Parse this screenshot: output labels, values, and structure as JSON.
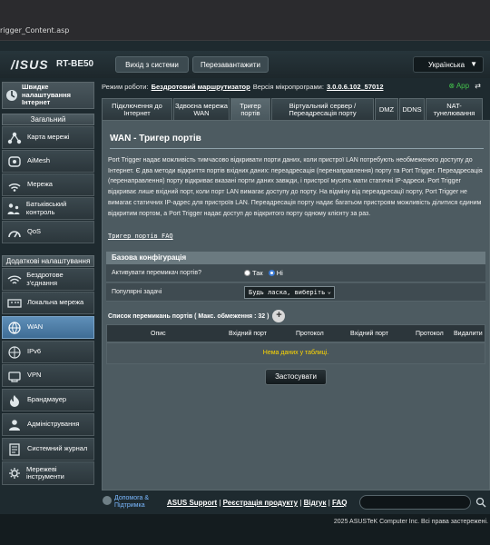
{
  "browser": {
    "url": "rigger_Content.asp"
  },
  "header": {
    "logo": "/ISUS",
    "model": "RT-BE50",
    "logout_label": "Вихід з системи",
    "reboot_label": "Перезавантажити",
    "language": "Українська"
  },
  "status": {
    "mode_label": "Режим роботи:",
    "mode_value": "Бездротовий маршрутизатор",
    "firmware_label": "Версія мікропрограми:",
    "firmware_value": "3.0.0.6.102_57012",
    "app_label": "App"
  },
  "sidebar": {
    "quick_setup": "Швидке налаштування Інтернет",
    "general_header": "Загальний",
    "general_items": [
      {
        "label": "Карта мережі",
        "icon": "network-map-icon"
      },
      {
        "label": "AiMesh",
        "icon": "aimesh-icon"
      },
      {
        "label": "Мережа",
        "icon": "network-icon"
      },
      {
        "label": "Батьківський контроль",
        "icon": "parental-icon"
      },
      {
        "label": "QoS",
        "icon": "qos-icon"
      }
    ],
    "advanced_header": "Додаткові налаштування",
    "advanced_items": [
      {
        "label": "Бездротове з'єднання",
        "icon": "wireless-icon"
      },
      {
        "label": "Локальна мережа",
        "icon": "lan-icon"
      },
      {
        "label": "WAN",
        "icon": "wan-icon"
      },
      {
        "label": "IPv6",
        "icon": "ipv6-icon"
      },
      {
        "label": "VPN",
        "icon": "vpn-icon"
      },
      {
        "label": "Брандмауер",
        "icon": "firewall-icon"
      },
      {
        "label": "Адміністрування",
        "icon": "admin-icon"
      },
      {
        "label": "Системний журнал",
        "icon": "log-icon"
      },
      {
        "label": "Мережеві інструменти",
        "icon": "tools-icon"
      }
    ]
  },
  "tabs": [
    "Підключення до Інтернет",
    "Здвоєна мережа WAN",
    "Тригер портів",
    "Віртуальний сервер / Переадресація порту",
    "DMZ",
    "DDNS",
    "NAT-тунелювання"
  ],
  "main": {
    "title": "WAN - Тригер портів",
    "description": "Port Trigger надає можливість тимчасово відкривати порти даних, коли пристрої LAN потребують необмеженого доступу до Інтернет. Є два методи відкриття портів вхідних даних: переадресація (перенаправлення) порту та Port Trigger. Переадресація (перенаправлення) порту відкриває вказані порти даних завжди, і пристрої мусить мати статичні IP-адреси. Port Trigger відкриває лише вхідний порт, коли порт LAN вимагає доступу до порту. На відміну від переадресації порту, Port Trigger не вимагає статичних IP-адрес для пристроїв LAN. Переадресація порту надає багатьом пристроям можливість ділитися єдиним відкритим портом, а Port Trigger надає доступ до відкритого порту одному клієнту за раз.",
    "faq_link": "Тригер портів FAQ",
    "basic_config": "Базова конфігурація",
    "enable_label": "Активувати перемикач портів?",
    "radio_yes": "Так",
    "radio_no": "Ні",
    "popular_label": "Популярні задачі",
    "popular_value": "Будь ласка, виберіть",
    "list_title": "Список перемикань портів ( Макс. обмеження : 32 )",
    "columns": [
      "Опис",
      "Вхідний порт",
      "Протокол",
      "Вхідний порт",
      "Протокол",
      "Видалити"
    ],
    "no_data": "Нема даних у таблиці.",
    "apply_label": "Застосувати"
  },
  "footer": {
    "help": "Допомога & Підтримка",
    "links": [
      "ASUS Support",
      "Реєстрація продукту",
      "Відгук",
      "FAQ"
    ],
    "copyright": "2025 ASUSTeK Computer Inc. Всі права застережені."
  }
}
